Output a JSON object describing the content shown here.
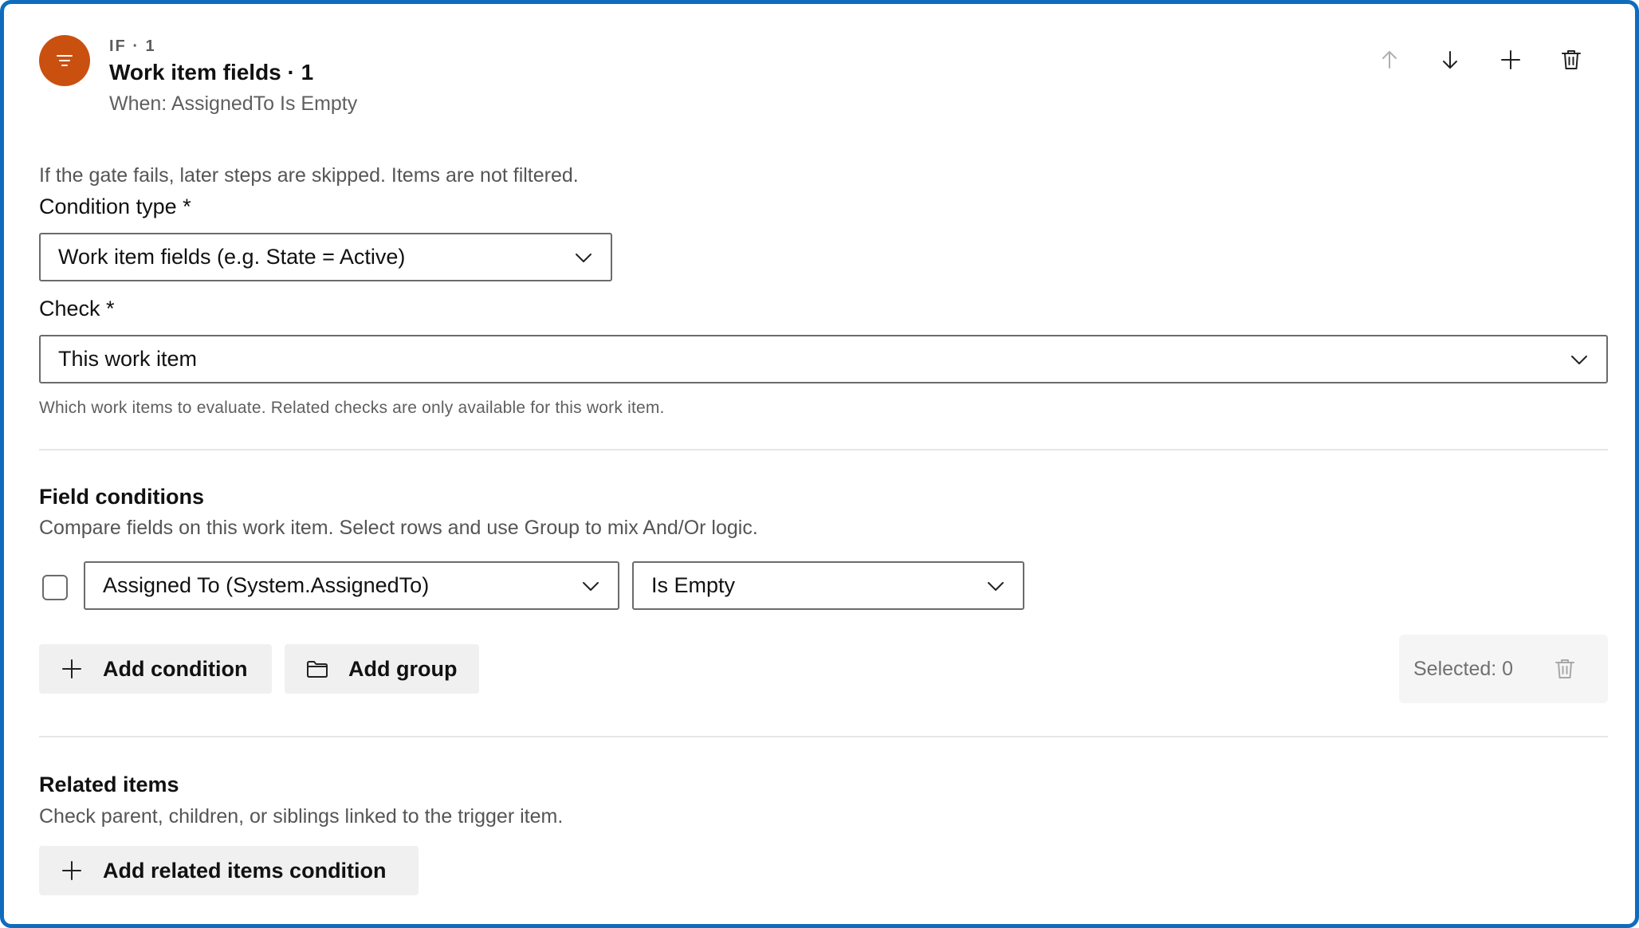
{
  "step": {
    "kicker": "IF · 1",
    "title": "Work item fields · 1",
    "summary": "When: AssignedTo Is Empty",
    "icon": "filter-icon",
    "accent": "#ca5010"
  },
  "actions": {
    "move_up": "arrow-up-icon",
    "move_down": "arrow-down-icon",
    "add": "plus-icon",
    "delete": "trash-icon"
  },
  "gate_note": "If the gate fails, later steps are skipped. Items are not filtered.",
  "condition_type": {
    "label": "Condition type *",
    "value": "Work item fields (e.g. State = Active)"
  },
  "check": {
    "label": "Check *",
    "value": "This work item",
    "help": "Which work items to evaluate. Related checks are only available for this work item."
  },
  "field_conditions": {
    "title": "Field conditions",
    "description": "Compare fields on this work item. Select rows and use Group to mix And/Or logic.",
    "rows": [
      {
        "checked": false,
        "field": "Assigned To (System.AssignedTo)",
        "operator": "Is Empty"
      }
    ],
    "add_condition_label": "Add condition",
    "add_group_label": "Add group",
    "selected_label": "Selected: 0"
  },
  "related_items": {
    "title": "Related items",
    "description": "Check parent, children, or siblings linked to the trigger item.",
    "add_label": "Add related items condition"
  },
  "colors": {
    "border": "#0f6cbd",
    "button_bg": "#f0f0f0"
  }
}
